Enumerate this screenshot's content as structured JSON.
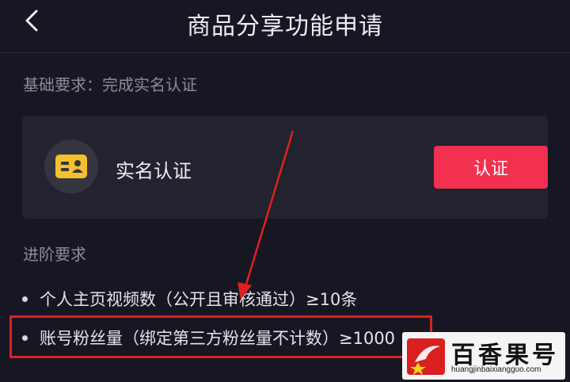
{
  "header": {
    "title": "商品分享功能申请",
    "back_icon": "chevron-left-icon"
  },
  "basic": {
    "label": "基础要求：完成实名认证",
    "card": {
      "icon": "id-card-icon",
      "label": "实名认证",
      "button": "认证"
    }
  },
  "advanced": {
    "label": "进阶要求",
    "items": [
      "个人主页视频数（公开且审核通过）≥10条",
      "账号粉丝量（绑定第三方粉丝量不计数）≥1000"
    ]
  },
  "annotation": {
    "color": "#e02020"
  },
  "watermark": {
    "title": "百香果号",
    "url": "huangjinbaixiangguo.com"
  },
  "colors": {
    "background": "#161722",
    "card": "#22232f",
    "accent": "#f2304f"
  }
}
